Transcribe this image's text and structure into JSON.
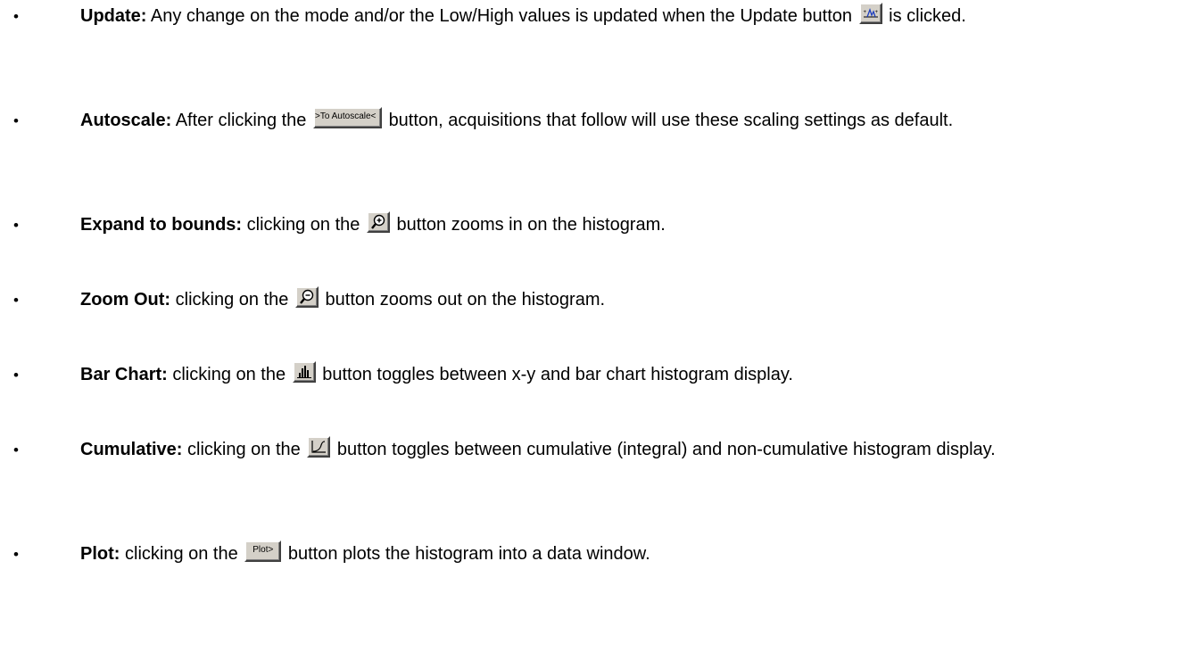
{
  "items": [
    {
      "term": "Update:",
      "before": "Any change on the mode and/or the Low/High values is updated when the Update button",
      "after": "is clicked.",
      "button": {
        "kind": "icon",
        "icon": "update-icon"
      }
    },
    {
      "term": "Autoscale:",
      "before": "After clicking the",
      "after": "button, acquisitions that follow will use these scaling settings as default.",
      "button": {
        "kind": "text",
        "label": ">To Autoscale<"
      }
    },
    {
      "term": "Expand to bounds:",
      "before": "clicking on the",
      "after": "button zooms in on the histogram.",
      "button": {
        "kind": "icon",
        "icon": "zoom-in-icon"
      }
    },
    {
      "term": "Zoom Out:",
      "before": "clicking on the",
      "after": "button zooms out on the histogram.",
      "button": {
        "kind": "icon",
        "icon": "zoom-out-icon"
      }
    },
    {
      "term": "Bar Chart:",
      "before": "clicking on the",
      "after": "button toggles between x-y and bar chart histogram display.",
      "button": {
        "kind": "icon",
        "icon": "bar-chart-icon"
      }
    },
    {
      "term": "Cumulative:",
      "before": "clicking on the",
      "after": "button toggles between cumulative (integral) and non-cumulative histogram display.",
      "button": {
        "kind": "icon",
        "icon": "cumulative-icon"
      }
    },
    {
      "term": "Plot:",
      "before": "clicking on the",
      "after": "button plots the histogram into a data window.",
      "button": {
        "kind": "text",
        "label": "Plot>"
      }
    }
  ],
  "bullet_glyph": "•",
  "colors": {
    "text": "#000000",
    "page_background": "#ffffff",
    "button_face": "#d4d0c8",
    "icon_blue": "#1f3fbf"
  }
}
